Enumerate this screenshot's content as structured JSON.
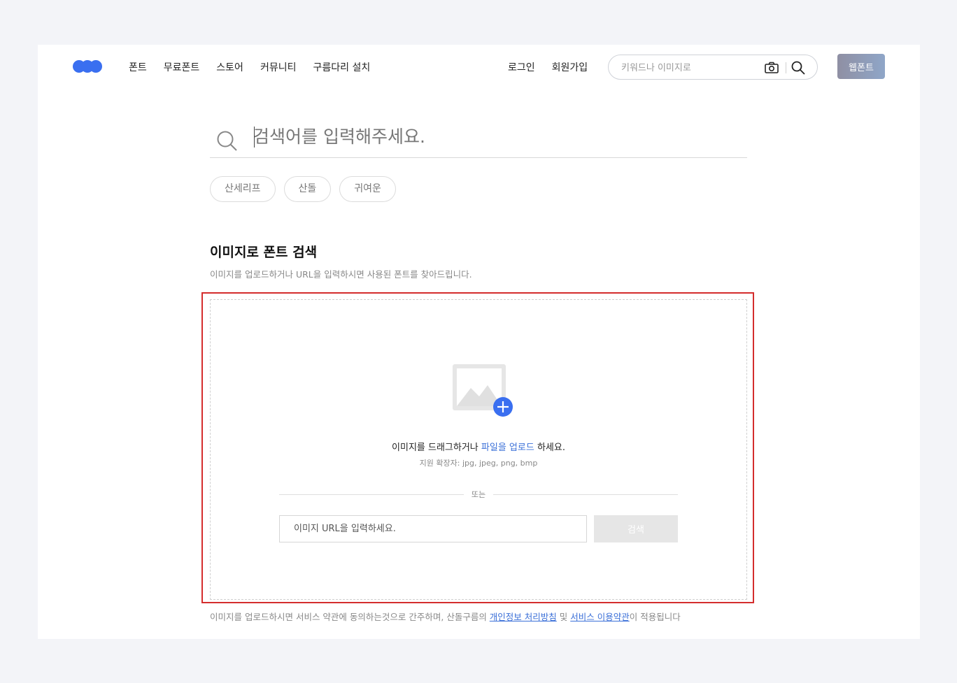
{
  "header": {
    "nav": [
      "폰트",
      "무료폰트",
      "스토어",
      "커뮤니티",
      "구름다리 설치"
    ],
    "login": "로그인",
    "signup": "회원가입",
    "search_placeholder": "키워드나 이미지로",
    "webfont_label": "웹폰트",
    "brand_color": "#3a6ff0"
  },
  "search": {
    "placeholder": "검색어를 입력해주세요.",
    "tags": [
      "산세리프",
      "산돌",
      "귀여운"
    ]
  },
  "image_search": {
    "title": "이미지로 폰트 검색",
    "description": "이미지를 업로드하거나 URL을 입력하시면 사용된 폰트를 찾아드립니다.",
    "drop_text_before": "이미지를 드래그하거나 ",
    "drop_link": "파일을 업로드",
    "drop_text_after": " 하세요.",
    "extensions": "지원 확장자: jpg, jpeg, png, bmp",
    "or": "또는",
    "url_placeholder": "이미지 URL을 입력하세요.",
    "search_button": "검색",
    "highlight_color": "#d42d2d"
  },
  "footer_note": {
    "before": "이미지를 업로드하시면 서비스 약관에 동의하는것으로 간주하며, 산돌구름의 ",
    "privacy_link": "개인정보 처리방침",
    "middle": " 및 ",
    "terms_link": "서비스 이용약관",
    "after": "이 적용됩니다"
  }
}
